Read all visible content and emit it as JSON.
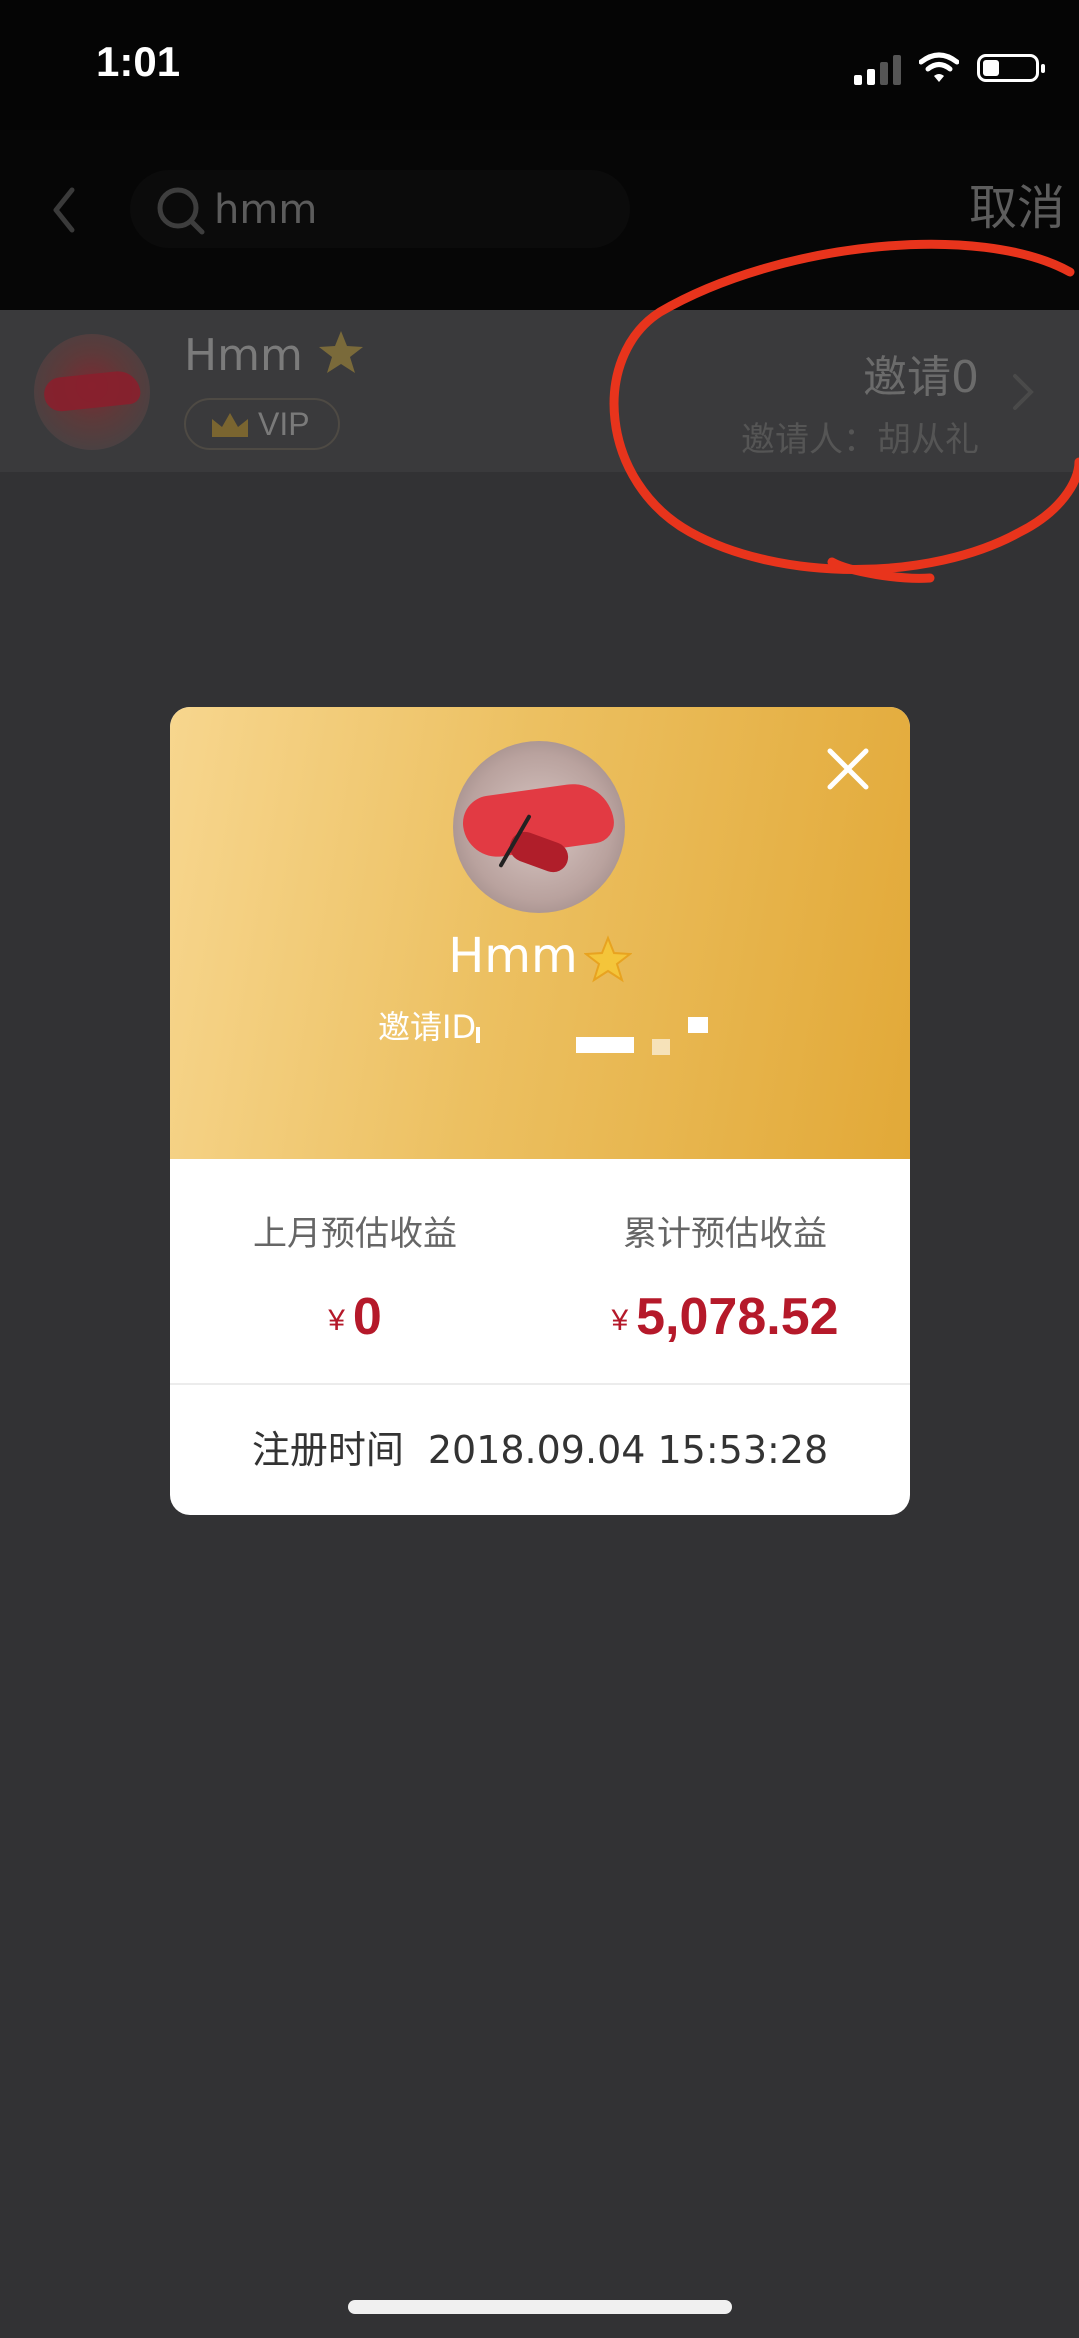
{
  "status_bar": {
    "time": "1:01"
  },
  "search": {
    "query": "hmm",
    "cancel_label": "取消"
  },
  "result": {
    "name": "Hmm",
    "vip_label": "VIP",
    "invite_count": "邀请0",
    "inviter": "邀请人：胡从礼"
  },
  "modal": {
    "name": "Hmm",
    "invite_id_label": "邀请ID",
    "last_month_label": "上月预估收益",
    "last_month_currency": "¥",
    "last_month_value": "0",
    "total_label": "累计预估收益",
    "total_currency": "¥",
    "total_value": "5,078.52",
    "register_label": "注册时间",
    "register_time": "2018.09.04 15:53:28"
  },
  "colors": {
    "accent_red": "#b5192a",
    "gold_start": "#f7d68e",
    "gold_end": "#e2a938",
    "annotation_red": "#e8341c"
  }
}
